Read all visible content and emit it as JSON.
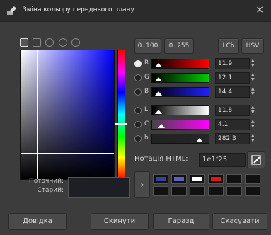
{
  "window": {
    "title": "Зміна кольору переднього плану",
    "close_glyph": "×"
  },
  "selector_icons": [
    "gimp-icon",
    "watercolor-icon",
    "circle-icon",
    "wheel-icon",
    "cmyk-icon"
  ],
  "range_buttons": {
    "r100": "0..100",
    "r255": "0..255"
  },
  "mode_buttons": {
    "lch": "LCh",
    "hsv": "HSV"
  },
  "channels": [
    {
      "id": "r",
      "label": "R",
      "value": "11.9",
      "selected": true,
      "gradient": "linear-gradient(to right, #000, #ff0000)"
    },
    {
      "id": "g",
      "label": "G",
      "value": "12.1",
      "selected": false,
      "gradient": "linear-gradient(to right, #000, #00cc00)"
    },
    {
      "id": "b",
      "label": "B",
      "value": "14.4",
      "selected": false,
      "gradient": "linear-gradient(to right, #000, #2020ff)"
    },
    {
      "id": "l",
      "label": "L",
      "value": "11.8",
      "selected": false,
      "gradient": "linear-gradient(to right, #000, #fff)"
    },
    {
      "id": "c",
      "label": "C",
      "value": "4.1",
      "selected": false,
      "gradient": "linear-gradient(to right, #444, #ff00ff)"
    },
    {
      "id": "h",
      "label": "h",
      "value": "282.3",
      "selected": false,
      "gradient": "linear-gradient(to right, #222, #262626)"
    }
  ],
  "hex": {
    "label": "Нотація HTML:",
    "value": "1e1f25"
  },
  "swatch": {
    "current_label": "Поточний:",
    "old_label": "Старий:",
    "current_color": "#1e1f25"
  },
  "history": {
    "arrow": "›",
    "colors": [
      "#3a3f9a",
      "#5a64c0",
      "#ffffff",
      "#e01818",
      "#111111",
      "#111111",
      "#111111",
      "#111111",
      "#111111",
      "#111111",
      "#111111",
      "#111111"
    ]
  },
  "buttons": {
    "help": "Довідка",
    "reset": "Скинути",
    "ok": "Гаразд",
    "cancel": "Скасувати"
  }
}
